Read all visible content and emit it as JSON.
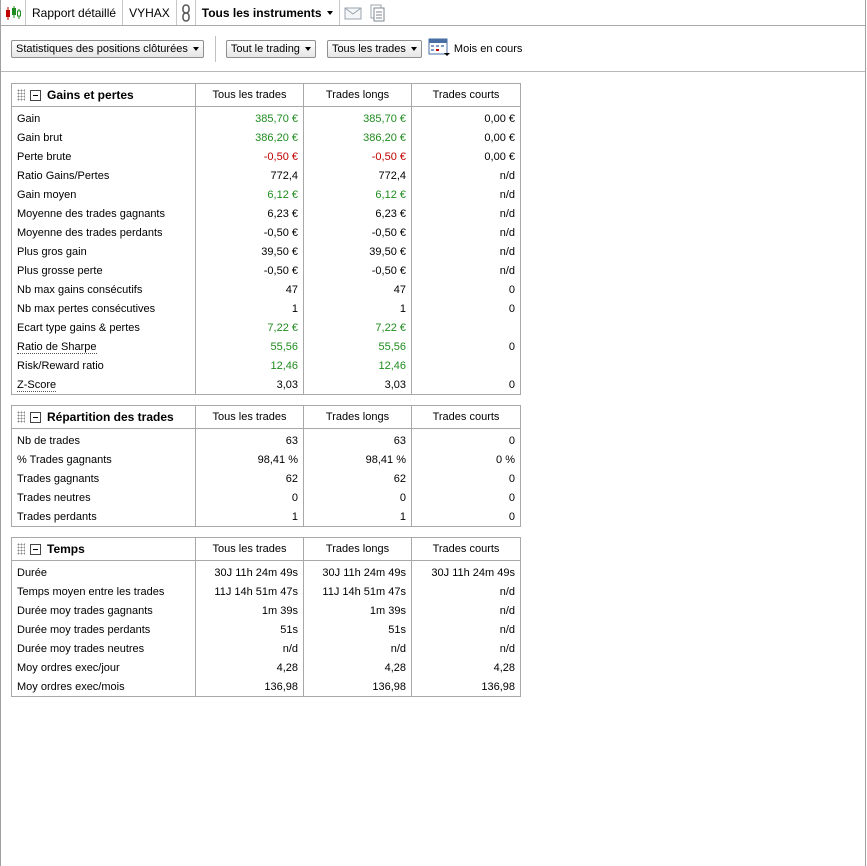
{
  "tabbar": {
    "report_label": "Rapport détaillé",
    "account": "VYHAX",
    "instruments_label": "Tous les instruments"
  },
  "toolbar": {
    "stats_dropdown": "Statistiques des positions clôturées",
    "trading_dropdown": "Tout le trading",
    "trades_dropdown": "Tous les trades",
    "period_label": "Mois en cours"
  },
  "sections": {
    "gains": {
      "title": "Gains et pertes",
      "columns": [
        "Tous les trades",
        "Trades longs",
        "Trades courts"
      ],
      "rows": [
        {
          "label": "Gain",
          "values": [
            "385,70 €",
            "385,70 €",
            "0,00 €"
          ]
        },
        {
          "label": "Gain brut",
          "values": [
            "386,20 €",
            "386,20 €",
            "0,00 €"
          ]
        },
        {
          "label": "Perte brute",
          "values": [
            "-0,50 €",
            "-0,50 €",
            "0,00 €"
          ]
        },
        {
          "label": "Ratio Gains/Pertes",
          "values": [
            "772,4",
            "772,4",
            "n/d"
          ]
        },
        {
          "label": "Gain moyen",
          "values": [
            "6,12 €",
            "6,12 €",
            "n/d"
          ]
        },
        {
          "label": "Moyenne des trades gagnants",
          "values": [
            "6,23 €",
            "6,23 €",
            "n/d"
          ]
        },
        {
          "label": "Moyenne des trades perdants",
          "values": [
            "-0,50 €",
            "-0,50 €",
            "n/d"
          ]
        },
        {
          "label": "Plus gros gain",
          "values": [
            "39,50 €",
            "39,50 €",
            "n/d"
          ]
        },
        {
          "label": "Plus grosse perte",
          "values": [
            "-0,50 €",
            "-0,50 €",
            "n/d"
          ]
        },
        {
          "label": "Nb max gains consécutifs",
          "values": [
            "47",
            "47",
            "0"
          ]
        },
        {
          "label": "Nb max pertes consécutives",
          "values": [
            "1",
            "1",
            "0"
          ]
        },
        {
          "label": "Ecart type gains & pertes",
          "values": [
            "7,22 €",
            "7,22 €",
            ""
          ]
        },
        {
          "label": "Ratio de Sharpe",
          "values": [
            "55,56",
            "55,56",
            "0"
          ]
        },
        {
          "label": "Risk/Reward ratio",
          "values": [
            "12,46",
            "12,46",
            ""
          ]
        },
        {
          "label": "Z-Score",
          "values": [
            "3,03",
            "3,03",
            "0"
          ]
        }
      ]
    },
    "repartition": {
      "title": "Répartition des trades",
      "columns": [
        "Tous les trades",
        "Trades longs",
        "Trades courts"
      ],
      "rows": [
        {
          "label": "Nb de trades",
          "values": [
            "63",
            "63",
            "0"
          ]
        },
        {
          "label": "% Trades gagnants",
          "values": [
            "98,41 %",
            "98,41 %",
            "0 %"
          ]
        },
        {
          "label": "Trades gagnants",
          "values": [
            "62",
            "62",
            "0"
          ]
        },
        {
          "label": "Trades neutres",
          "values": [
            "0",
            "0",
            "0"
          ]
        },
        {
          "label": "Trades perdants",
          "values": [
            "1",
            "1",
            "0"
          ]
        }
      ]
    },
    "temps": {
      "title": "Temps",
      "columns": [
        "Tous les trades",
        "Trades longs",
        "Trades courts"
      ],
      "rows": [
        {
          "label": "Durée",
          "values": [
            "30J 11h 24m 49s",
            "30J 11h 24m 49s",
            "30J 11h 24m 49s"
          ]
        },
        {
          "label": "Temps moyen entre les trades",
          "values": [
            "11J 14h 51m 47s",
            "11J 14h 51m 47s",
            "n/d"
          ]
        },
        {
          "label": "Durée moy trades gagnants",
          "values": [
            "1m 39s",
            "1m 39s",
            "n/d"
          ]
        },
        {
          "label": "Durée moy trades perdants",
          "values": [
            "51s",
            "51s",
            "n/d"
          ]
        },
        {
          "label": "Durée moy trades neutres",
          "values": [
            "n/d",
            "n/d",
            "n/d"
          ]
        },
        {
          "label": "Moy ordres exec/jour",
          "values": [
            "4,28",
            "4,28",
            "4,28"
          ]
        },
        {
          "label": "Moy ordres exec/mois",
          "values": [
            "136,98",
            "136,98",
            "136,98"
          ]
        }
      ]
    }
  },
  "colors": {
    "positive": "#1f8c1f",
    "negative": "#c00000",
    "border": "#a8a8a8"
  },
  "icons": {
    "app_logo": "candlestick-chart-icon",
    "link": "link-chain-icon",
    "email": "email-icon",
    "document": "document-icon",
    "calendar": "calendar-icon"
  }
}
